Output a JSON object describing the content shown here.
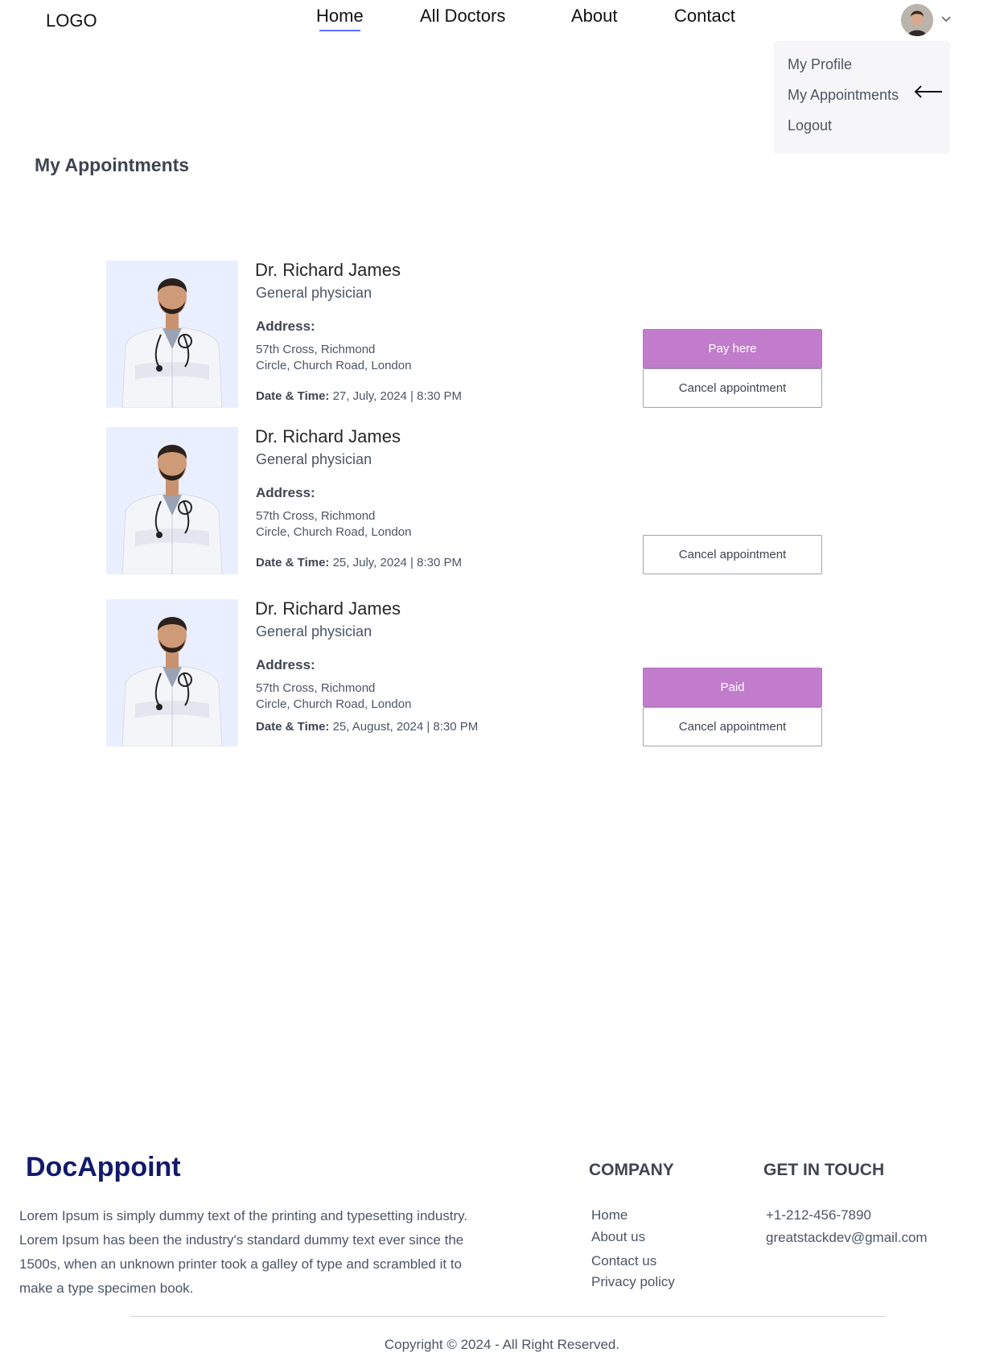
{
  "header": {
    "logo": "LOGO",
    "nav": [
      "Home",
      "All Doctors",
      "About",
      "Contact"
    ]
  },
  "profile_menu": {
    "items": [
      "My Profile",
      "My Appointments",
      "Logout"
    ]
  },
  "page_title": "My Appointments",
  "appointments": [
    {
      "name": "Dr. Richard James",
      "speciality": "General physician",
      "address_label": "Address:",
      "address_line1": "57th Cross, Richmond",
      "address_line2": "Circle, Church Road, London",
      "datetime_label": "Date & Time:",
      "datetime": "27, July, 2024 |  8:30 PM",
      "primary_button": "Pay here",
      "cancel_button": "Cancel appointment"
    },
    {
      "name": "Dr. Richard James",
      "speciality": "General physician",
      "address_label": "Address:",
      "address_line1": "57th Cross, Richmond",
      "address_line2": "Circle, Church Road, London",
      "datetime_label": "Date & Time:",
      "datetime": "25, July, 2024 |  8:30 PM",
      "cancel_button": "Cancel appointment"
    },
    {
      "name": "Dr. Richard James",
      "speciality": "General physician",
      "address_label": "Address:",
      "address_line1": "57th Cross, Richmond",
      "address_line2": "Circle, Church Road, London",
      "datetime_label": "Date & Time:",
      "datetime": "25, August, 2024 |  8:30 PM",
      "primary_button": "Paid",
      "cancel_button": "Cancel appointment"
    }
  ],
  "footer": {
    "brand": "DocAppoint",
    "description": "Lorem Ipsum is simply dummy text of the printing and typesetting industry. Lorem Ipsum has been the industry's standard dummy text ever since the 1500s, when an unknown printer took a galley of type and scrambled it to make a type specimen book.",
    "company_heading": "COMPANY",
    "company_links": [
      "Home",
      "About us",
      "Contact us",
      "Privacy policy"
    ],
    "contact_heading": "GET IN TOUCH",
    "phone": "+1-212-456-7890",
    "email": "greatstackdev@gmail.com",
    "copyright": "Copyright © 2024 - All Right Reserved."
  },
  "colors": {
    "accent": "#5f6fff",
    "pay_button": "#c27ccc",
    "brand": "#121a6b",
    "doctor_bg": "#eaefff"
  }
}
